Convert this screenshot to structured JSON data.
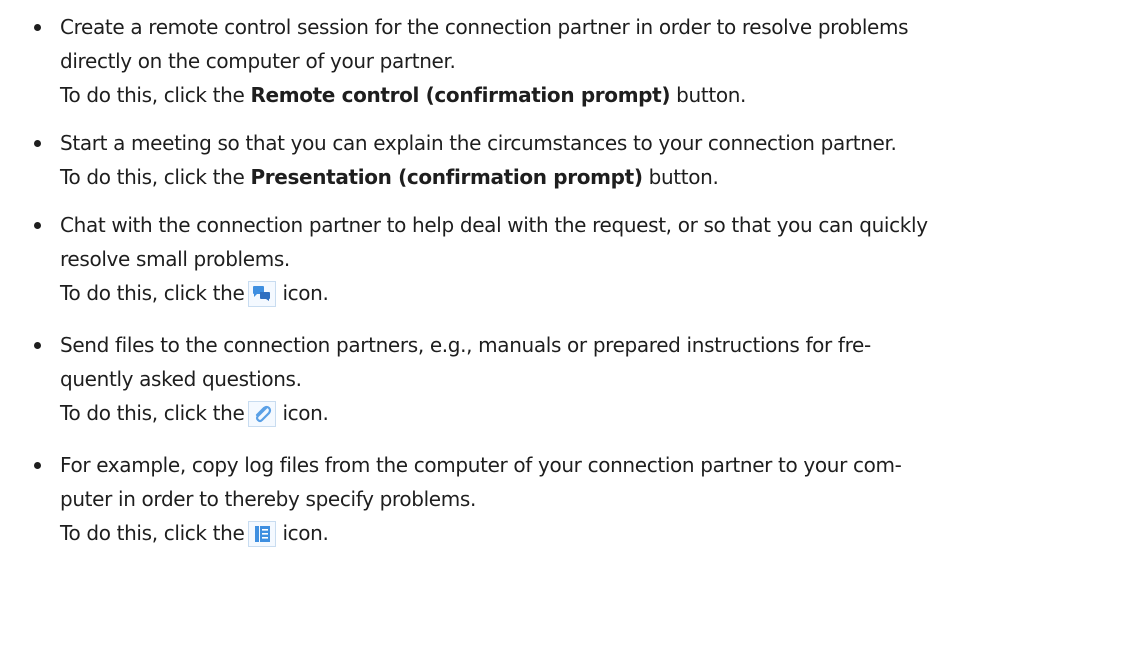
{
  "items": [
    {
      "lines": [
        "Create a remote control session for the connection partner in order to resolve problems",
        "directly on the computer of your partner."
      ],
      "instruction": {
        "prefix": "To do this, click the ",
        "button": "Remote control (confirmation prompt)",
        "suffix": " button."
      }
    },
    {
      "lines": [
        "Start a meeting so that you can explain the circumstances to your connection partner."
      ],
      "instruction": {
        "prefix": "To do this, click the ",
        "button": "Presentation (confirmation prompt)",
        "suffix": " button."
      }
    },
    {
      "lines": [
        "Chat with the connection partner to help deal with the request, or so that you can quickly",
        "resolve small problems."
      ],
      "instruction": {
        "prefix": "To do this, click the",
        "icon": "chat-icon",
        "suffix": "icon."
      }
    },
    {
      "lines": [
        "Send files to the connection partners, e.g., manuals or prepared instructions for fre-",
        "quently asked questions."
      ],
      "instruction": {
        "prefix": "To do this, click the",
        "icon": "paperclip-icon",
        "suffix": "icon."
      }
    },
    {
      "lines": [
        "For example, copy log files from the computer of your connection partner to your com-",
        "puter in order to thereby specify problems."
      ],
      "instruction": {
        "prefix": "To do this, click the",
        "icon": "file-list-icon",
        "suffix": "icon."
      }
    }
  ],
  "colors": {
    "text": "#1e1e1e",
    "icon_blue": "#3f8fe0",
    "icon_border": "#c8dcf0"
  }
}
